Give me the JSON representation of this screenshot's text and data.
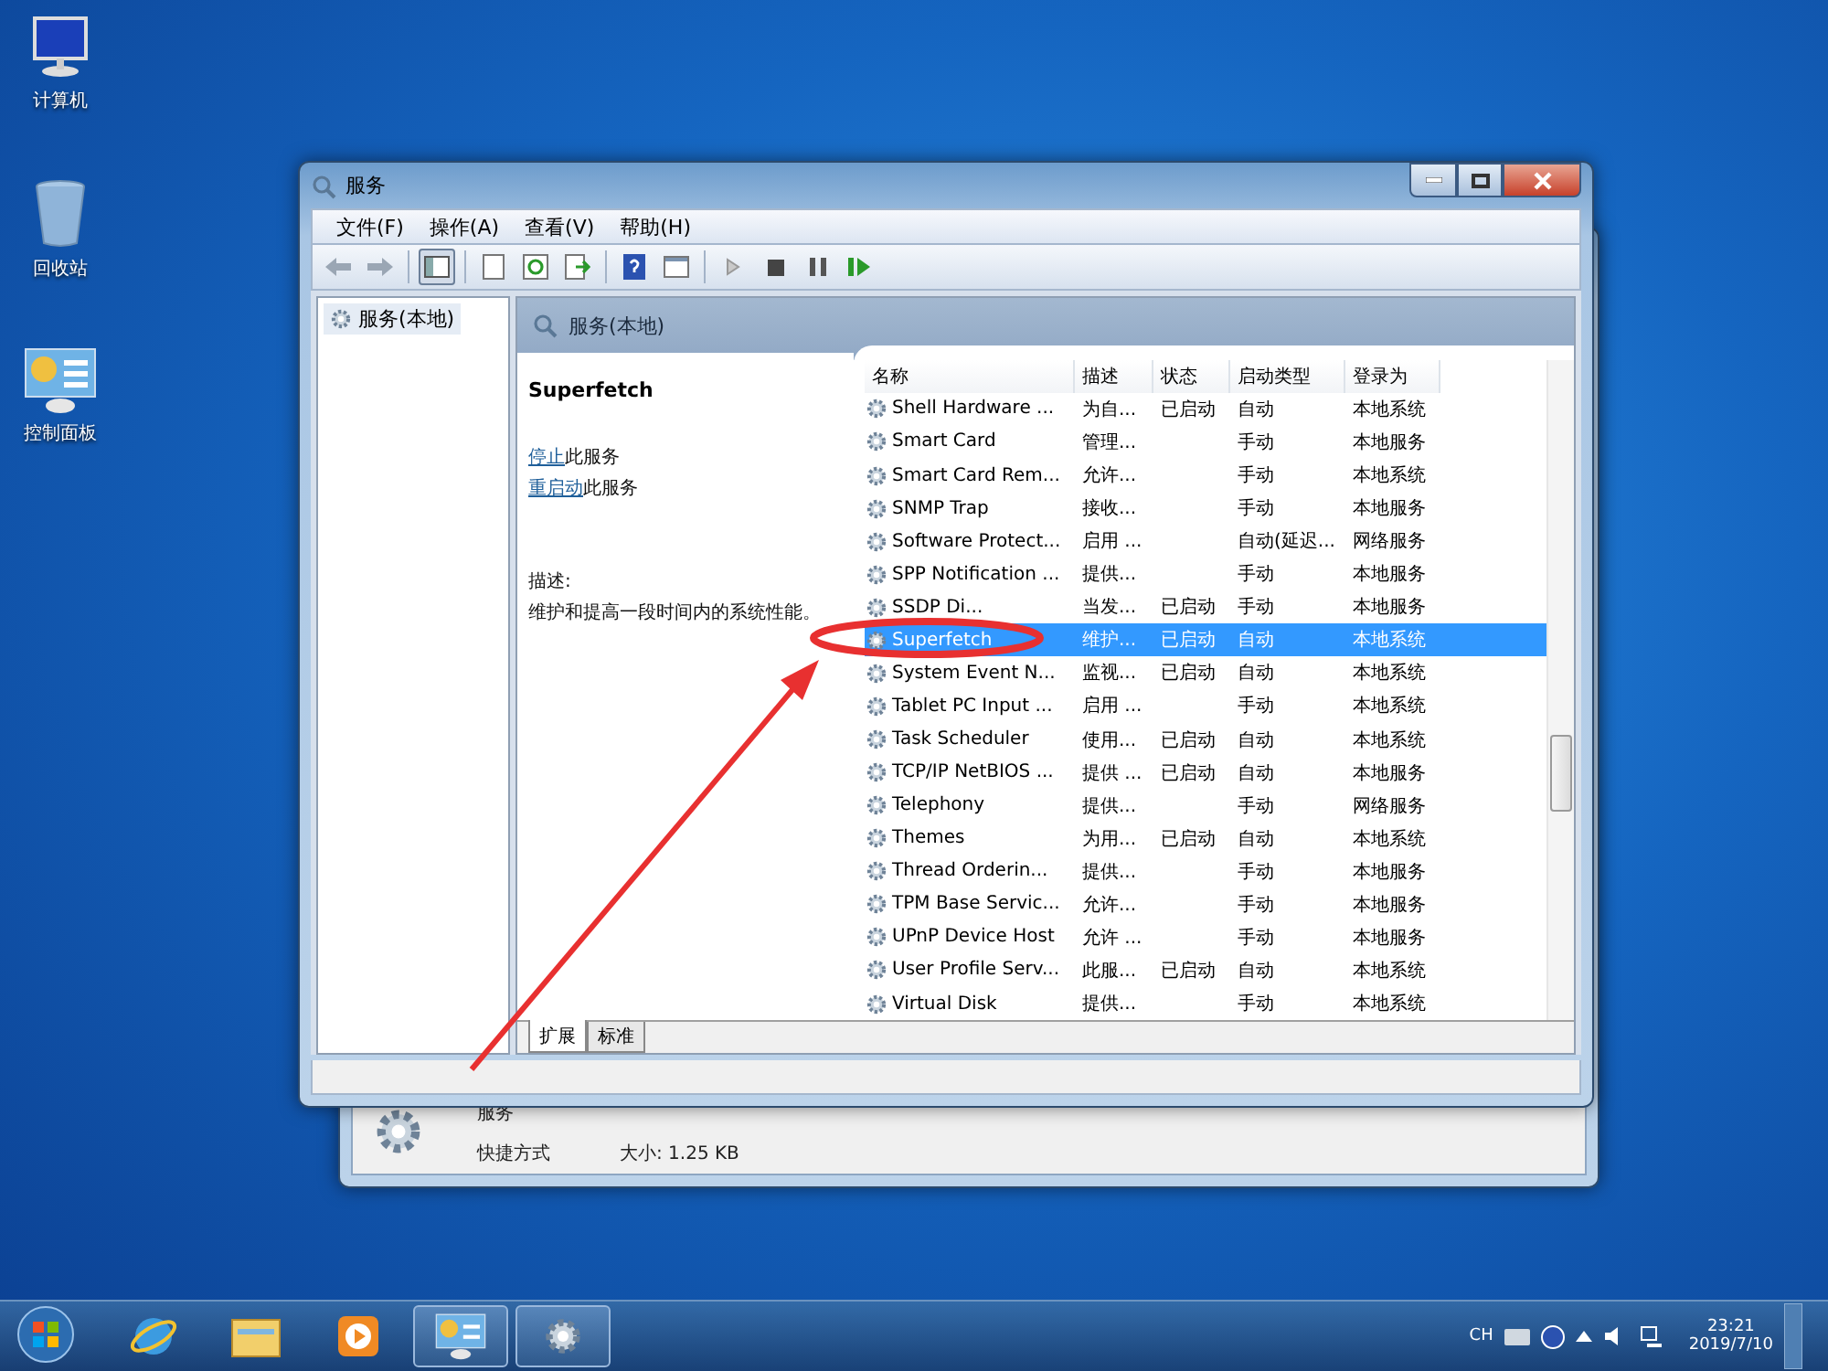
{
  "desktop_icons": [
    {
      "kind": "computer",
      "label": "计算机"
    },
    {
      "kind": "recycle",
      "label": "回收站"
    },
    {
      "kind": "control",
      "label": "控制面板"
    }
  ],
  "background_window": {
    "title": "服务",
    "shortcut_label": "快捷方式",
    "size": "大小: 1.25 KB"
  },
  "window": {
    "title": "服务",
    "menu": [
      "文件(F)",
      "操作(A)",
      "查看(V)",
      "帮助(H)"
    ],
    "tree": [
      {
        "label": "服务(本地)",
        "selected": true
      }
    ],
    "pane_title": "服务(本地)",
    "detail": {
      "name": "Superfetch",
      "actions": [
        {
          "link": "停止",
          "rest": "此服务"
        },
        {
          "link": "重启动",
          "rest": "此服务"
        }
      ],
      "description_label": "描述:",
      "description": "维护和提高一段时间内的系统性能。"
    },
    "table": {
      "columns": [
        "名称",
        "描述",
        "状态",
        "启动类型",
        "登录为"
      ],
      "rows": [
        {
          "name": "Shell Hardware ...",
          "description": "为自...",
          "status": "已启动",
          "startup": "自动",
          "logon": "本地系统",
          "selected": false
        },
        {
          "name": "Smart Card",
          "description": "管理...",
          "status": "",
          "startup": "手动",
          "logon": "本地服务",
          "selected": false
        },
        {
          "name": "Smart Card Rem...",
          "description": "允许...",
          "status": "",
          "startup": "手动",
          "logon": "本地系统",
          "selected": false
        },
        {
          "name": "SNMP Trap",
          "description": "接收...",
          "status": "",
          "startup": "手动",
          "logon": "本地服务",
          "selected": false
        },
        {
          "name": "Software Protect...",
          "description": "启用 ...",
          "status": "",
          "startup": "自动(延迟...",
          "logon": "网络服务",
          "selected": false
        },
        {
          "name": "SPP Notification ...",
          "description": "提供...",
          "status": "",
          "startup": "手动",
          "logon": "本地服务",
          "selected": false
        },
        {
          "name": "SSDP Di...",
          "description": "当发...",
          "status": "已启动",
          "startup": "手动",
          "logon": "本地服务",
          "selected": false
        },
        {
          "name": "Superfetch",
          "description": "维护...",
          "status": "已启动",
          "startup": "自动",
          "logon": "本地系统",
          "selected": true
        },
        {
          "name": "System Event N...",
          "description": "监视...",
          "status": "已启动",
          "startup": "自动",
          "logon": "本地系统",
          "selected": false
        },
        {
          "name": "Tablet PC Input ...",
          "description": "启用 ...",
          "status": "",
          "startup": "手动",
          "logon": "本地系统",
          "selected": false
        },
        {
          "name": "Task Scheduler",
          "description": "使用...",
          "status": "已启动",
          "startup": "自动",
          "logon": "本地系统",
          "selected": false
        },
        {
          "name": "TCP/IP NetBIOS ...",
          "description": "提供 ...",
          "status": "已启动",
          "startup": "自动",
          "logon": "本地服务",
          "selected": false
        },
        {
          "name": "Telephony",
          "description": "提供...",
          "status": "",
          "startup": "手动",
          "logon": "网络服务",
          "selected": false
        },
        {
          "name": "Themes",
          "description": "为用...",
          "status": "已启动",
          "startup": "自动",
          "logon": "本地系统",
          "selected": false
        },
        {
          "name": "Thread Orderin...",
          "description": "提供...",
          "status": "",
          "startup": "手动",
          "logon": "本地服务",
          "selected": false
        },
        {
          "name": "TPM Base Servic...",
          "description": "允许...",
          "status": "",
          "startup": "手动",
          "logon": "本地服务",
          "selected": false
        },
        {
          "name": "UPnP Device Host",
          "description": "允许 ...",
          "status": "",
          "startup": "手动",
          "logon": "本地服务",
          "selected": false
        },
        {
          "name": "User Profile Serv...",
          "description": "此服...",
          "status": "已启动",
          "startup": "自动",
          "logon": "本地系统",
          "selected": false
        },
        {
          "name": "Virtual Disk",
          "description": "提供...",
          "status": "",
          "startup": "手动",
          "logon": "本地系统",
          "selected": false
        }
      ]
    },
    "view_tabs": [
      {
        "label": "扩展",
        "selected": true
      },
      {
        "label": "标准",
        "selected": false
      }
    ]
  },
  "taskbar": {
    "items": [
      {
        "kind": "browser",
        "active": false
      },
      {
        "kind": "folder",
        "active": false
      },
      {
        "kind": "media",
        "active": false
      },
      {
        "kind": "control",
        "active": true
      },
      {
        "kind": "services",
        "active": true
      }
    ],
    "tray": {
      "language": "CH",
      "time": "23:21",
      "date": "2019/7/10"
    }
  }
}
